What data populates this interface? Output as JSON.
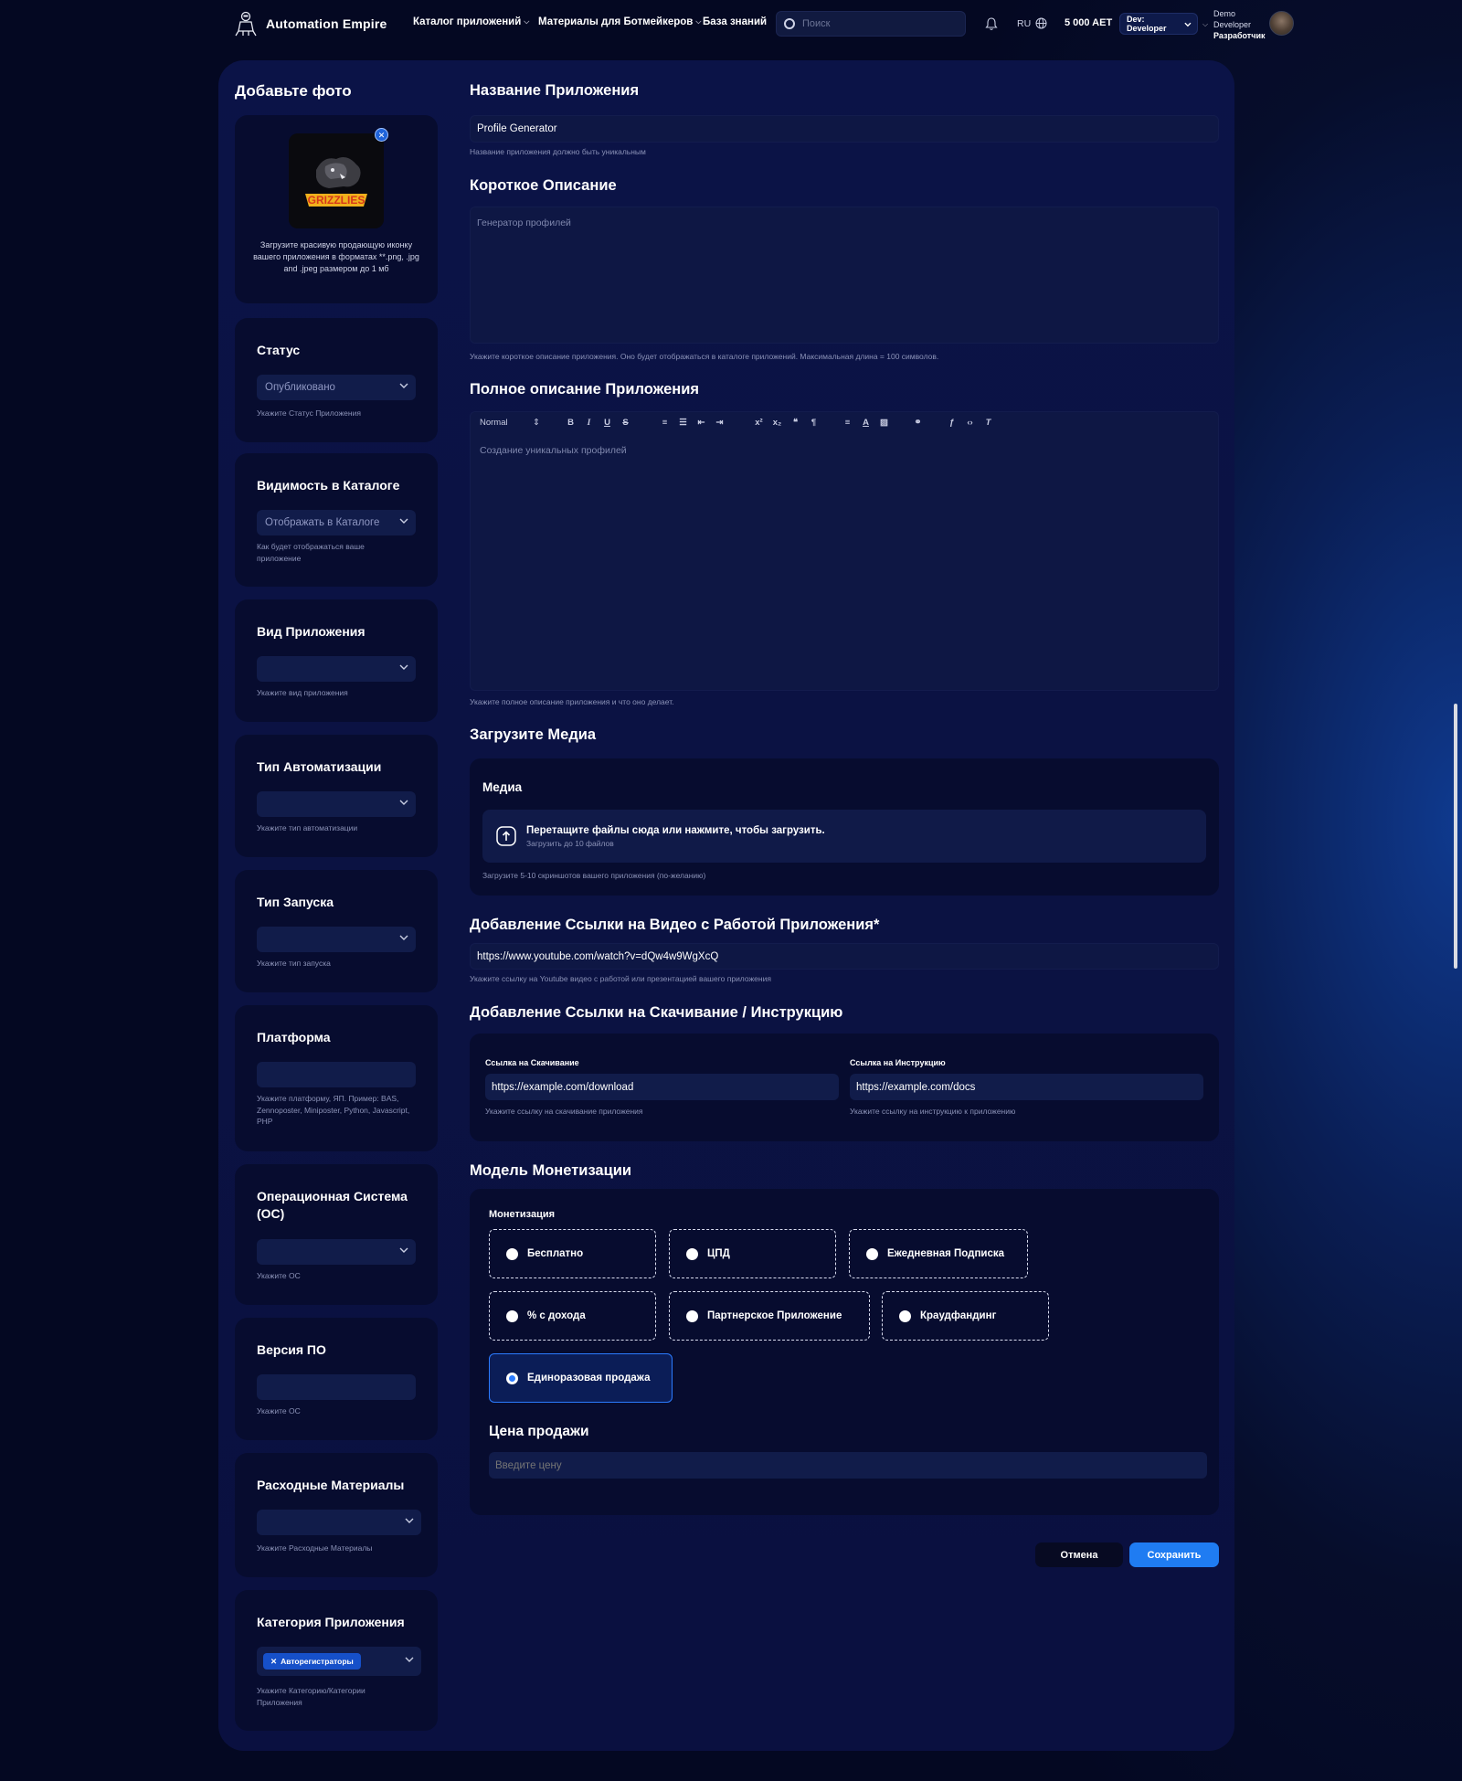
{
  "header": {
    "brand": "Automation Empire",
    "nav": [
      {
        "label": "Каталог приложений",
        "has_dropdown": true
      },
      {
        "label": "Материалы для Ботмейкеров",
        "has_dropdown": true
      },
      {
        "label": "База знаний",
        "has_dropdown": false
      }
    ],
    "search_placeholder": "Поиск",
    "language": "RU",
    "balance": "5 000 AET",
    "role_select": "Dev: Developer",
    "user_name_line1": "Demo",
    "user_name_line2": "Developer",
    "user_role": "Разработчик"
  },
  "sidebar": {
    "photo_title": "Добавьте фото",
    "photo_hint": "Загрузите красивую продающую иконку вашего приложения в форматах **.png, .jpg and .jpeg размером до 1 мб",
    "logo_text": "GRIZZLIES",
    "status": {
      "title": "Статус",
      "value": "Опубликовано",
      "hint": "Укажите Статус Приложения"
    },
    "visibility": {
      "title": "Видимость в Каталоге",
      "value": "Отображать в Каталоге",
      "hint": "Как будет отображаться ваше приложение"
    },
    "app_kind": {
      "title": "Вид Приложения",
      "value": "",
      "hint": "Укажите вид приложения"
    },
    "automation_type": {
      "title": "Тип Автоматизации",
      "value": "",
      "hint": "Укажите тип автоматизации"
    },
    "launch_type": {
      "title": "Тип Запуска",
      "value": "",
      "hint": "Укажите тип запуска"
    },
    "platform": {
      "title": "Платформа",
      "value": "",
      "hint": "Укажите платформу, ЯП. Пример: BAS, Zennoposter, Miniposter, Python, Javascript, PHP"
    },
    "os": {
      "title": "Операционная Система (ОС)",
      "value": "",
      "hint": "Укажите ОС"
    },
    "software_version": {
      "title": "Версия ПО",
      "value": "",
      "hint": "Укажите ОС"
    },
    "consumables": {
      "title": "Расходные Материалы",
      "value": "",
      "hint": "Укажите Расходные Материалы"
    },
    "category": {
      "title": "Категория Приложения",
      "chip": "Авторегистраторы",
      "hint": "Укажите Категорию/Категории Приложения"
    }
  },
  "main": {
    "name": {
      "title": "Название Приложения",
      "value": "Profile Generator",
      "hint": "Название приложения должно быть уникальным"
    },
    "short_desc": {
      "title": "Короткое Описание",
      "value": "Генератор профилей",
      "hint": "Укажите короткое описание приложения. Оно будет отображаться в каталоге приложений. Максимальная длина = 100 символов."
    },
    "full_desc": {
      "title": "Полное описание Приложения",
      "format": "Normal",
      "value": "Создание уникальных профилей",
      "hint": "Укажите полное описание приложения и что оно делает."
    },
    "media": {
      "title": "Загрузите Медиа",
      "box_title": "Медиа",
      "drop_text": "Перетащите файлы сюда или нажмите, чтобы загрузить.",
      "drop_sub": "Загрузить до 10 файлов",
      "hint": "Загрузите 5-10 скриншотов вашего приложения (по-желанию)"
    },
    "video": {
      "title": "Добавление Ссылки на Видео с Работой Приложения*",
      "value": "https://www.youtube.com/watch?v=dQw4w9WgXcQ",
      "hint": "Укажите ссылку на Youtube видео с работой или презентацией вашего приложения"
    },
    "links": {
      "title": "Добавление Ссылки на Скачивание / Инструкцию",
      "download_label": "Ссылка на Скачивание",
      "download_value": "https://example.com/download",
      "download_hint": "Укажите ссылку на скачивание приложения",
      "docs_label": "Ссылка на Инструкцию",
      "docs_value": "https://example.com/docs",
      "docs_hint": "Укажите ссылку на инструкцию к приложению"
    },
    "monetization": {
      "title": "Модель Монетизации",
      "box_label": "Монетизация",
      "options": [
        "Бесплатно",
        "ЦПД",
        "Ежедневная Подписка",
        "% с дохода",
        "Партнерское Приложение",
        "Краудфандинг",
        "Единоразовая продажа"
      ],
      "selected": "Единоразовая продажа",
      "price_title": "Цена продажи",
      "price_placeholder": "Введите цену"
    },
    "cancel_label": "Отмена",
    "save_label": "Сохранить"
  },
  "colors": {
    "accent": "#1f7cf2",
    "background": "#050a24",
    "card": "#070c2f",
    "field": "#111c4a"
  }
}
